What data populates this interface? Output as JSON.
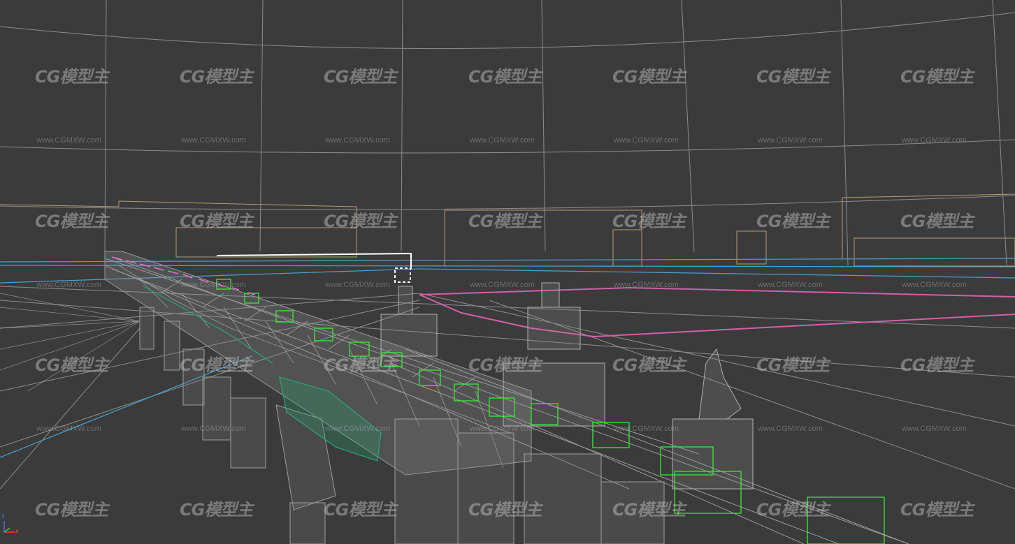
{
  "viewport": {
    "background": "#3b3b3b",
    "mode": "wireframe"
  },
  "colors": {
    "grid": "#a9a9a9",
    "mesh": "#9a9a9a",
    "selected_green": "#33ee33",
    "lamp_pink": "#e070d0",
    "guide_blue": "#4aa0d0",
    "frame_tan": "#b59c6e",
    "path_pink": "#d060a8",
    "teal": "#22aa77"
  },
  "watermark": {
    "logo_text": "CG模型主",
    "url_text": "www.CGMXW.com"
  },
  "gizmo": {
    "icon": "axis-gizmo-icon",
    "labels": [
      "z",
      "x"
    ]
  }
}
